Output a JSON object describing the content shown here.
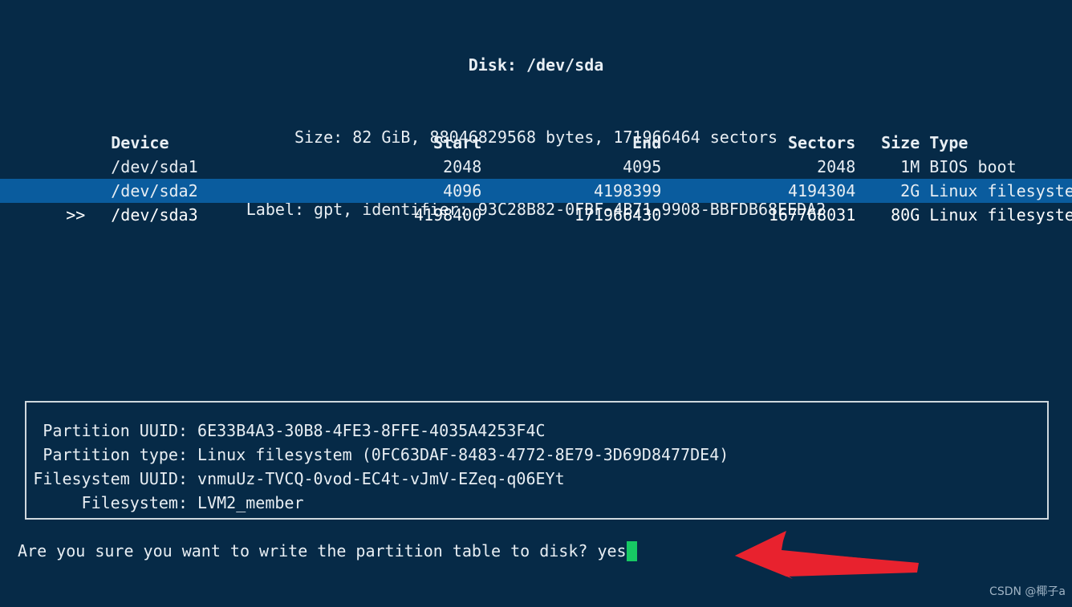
{
  "terminal": {
    "background_color": "#062a47",
    "foreground_color": "#e8eef3",
    "highlight_color": "#0a5c9e",
    "cursor_color": "#17c964",
    "annotation_color": "#e8222e"
  },
  "disk_header": {
    "title": "Disk: /dev/sda",
    "size_line": "Size: 82 GiB, 88046829568 bytes, 171966464 sectors",
    "label_line": "Label: gpt, identifier: 93C28B82-0FBF-4B71-9908-BBFDB68EEDA2"
  },
  "table": {
    "columns": [
      "Device",
      "Start",
      "End",
      "Sectors",
      "Size",
      "Type"
    ],
    "headers": {
      "device": "Device",
      "start": "Start",
      "end": "End",
      "sectors": "Sectors",
      "size": "Size",
      "type": "Type"
    },
    "selected_marker": ">>",
    "rows": [
      {
        "marker": "",
        "device": "/dev/sda1",
        "start": "2048",
        "end": "4095",
        "sectors": "2048",
        "size": "1M",
        "type": "BIOS boot",
        "selected": false
      },
      {
        "marker": "",
        "device": "/dev/sda2",
        "start": "4096",
        "end": "4198399",
        "sectors": "4194304",
        "size": "2G",
        "type": "Linux filesystem",
        "selected": false
      },
      {
        "marker": ">>",
        "device": "/dev/sda3",
        "start": "4198400",
        "end": "171966430",
        "sectors": "167768031",
        "size": "80G",
        "type": "Linux filesystem",
        "selected": true
      }
    ]
  },
  "detail_box": {
    "lines": [
      {
        "label": "Partition UUID:",
        "value": "6E33B4A3-30B8-4FE3-8FFE-4035A4253F4C"
      },
      {
        "label": "Partition type:",
        "value": "Linux filesystem (0FC63DAF-8483-4772-8E79-3D69D8477DE4)"
      },
      {
        "label": "Filesystem UUID:",
        "value": "vnmuUz-TVCQ-0vod-EC4t-vJmV-EZeq-q06EYt"
      },
      {
        "label": "Filesystem:",
        "value": "LVM2_member"
      }
    ]
  },
  "prompt": {
    "question": "Are you sure you want to write the partition table to disk? ",
    "answer": "yes"
  },
  "annotation": {
    "arrow_direction": "left",
    "color": "#e8222e"
  },
  "watermark": {
    "text": "CSDN @椰子a"
  }
}
